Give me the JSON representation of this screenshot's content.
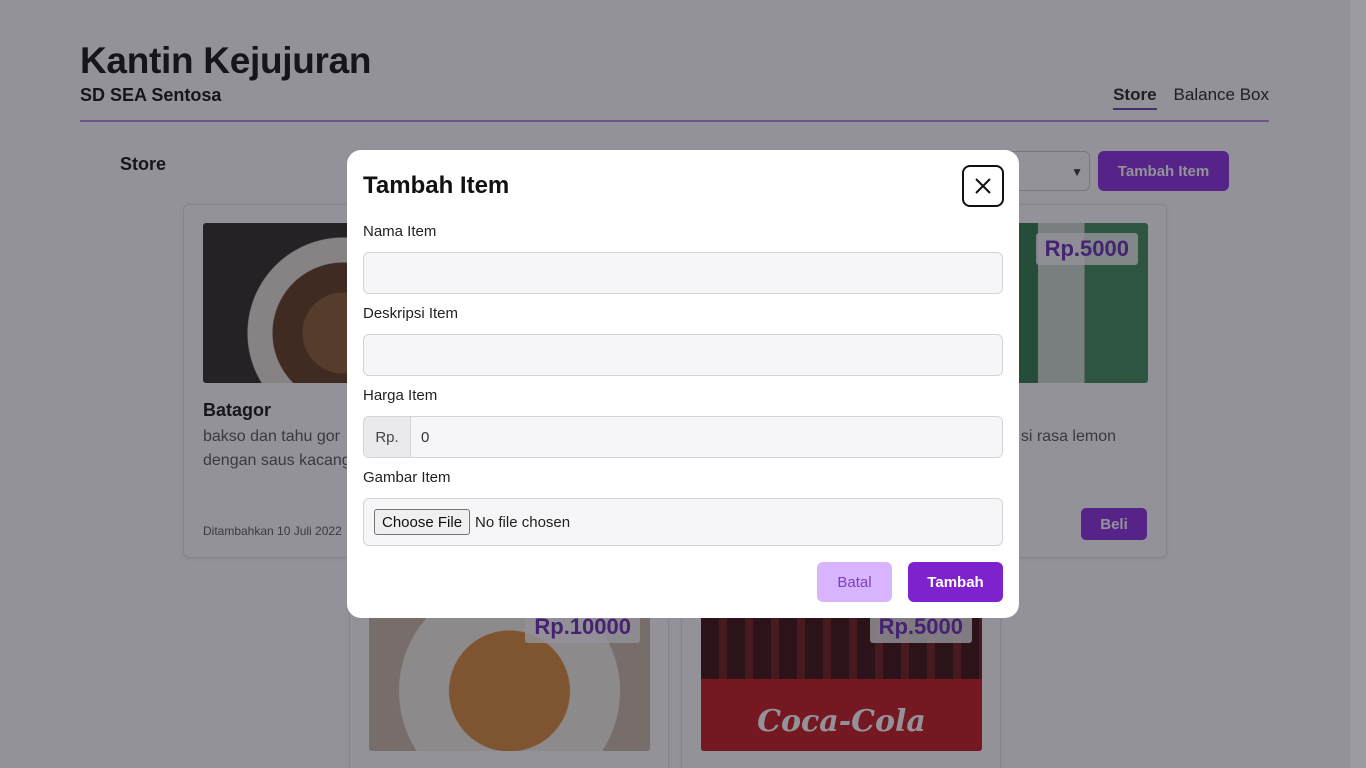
{
  "app": {
    "title": "Kantin Kejujuran",
    "subtitle": "SD SEA Sentosa"
  },
  "nav": {
    "items": [
      {
        "label": "Store",
        "active": true
      },
      {
        "label": "Balance Box",
        "active": false
      }
    ]
  },
  "store": {
    "heading": "Store",
    "add_button": "Tambah Item"
  },
  "cards": [
    {
      "name": "Batagor",
      "description": "bakso dan tahu gor",
      "description_line2": "dengan saus kacang",
      "date": "Ditambahkan 10 Juli 2022"
    },
    {
      "price": "Rp.5000",
      "description": "si rasa lemon",
      "buy_label": "Beli"
    },
    {
      "price": "Rp.10000"
    },
    {
      "price": "Rp.5000",
      "brand_text": "Coca-Cola"
    }
  ],
  "modal": {
    "title": "Tambah Item",
    "fields": {
      "name_label": "Nama Item",
      "name_value": "",
      "desc_label": "Deskripsi Item",
      "desc_value": "",
      "price_label": "Harga Item",
      "price_prefix": "Rp.",
      "price_value": "0",
      "image_label": "Gambar Item",
      "file_button": "Choose File",
      "file_status": "No file chosen"
    },
    "cancel_label": "Batal",
    "submit_label": "Tambah"
  },
  "colors": {
    "accent": "#7e22ce",
    "accent_light": "#d8b4fe",
    "price_text": "#6a2bb8"
  },
  "icons": {
    "close": "close-icon",
    "chevron": "chevron-down-icon"
  }
}
